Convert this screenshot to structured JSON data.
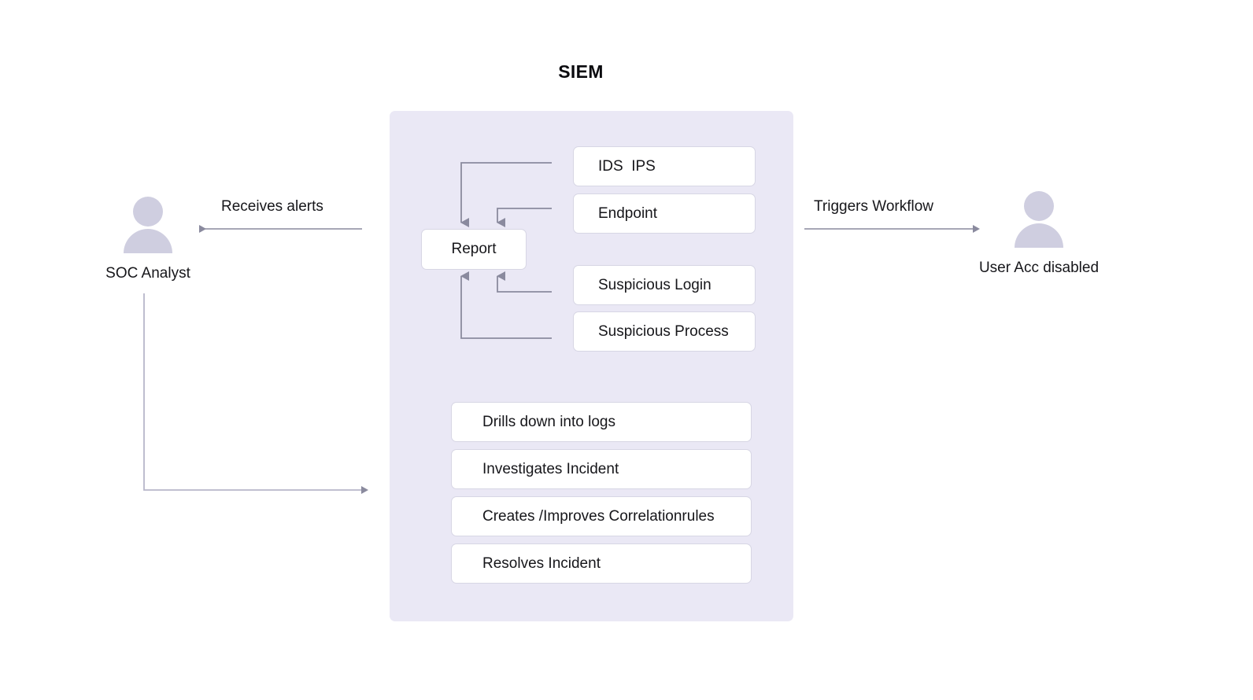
{
  "title": "SIEM",
  "colors": {
    "panel_background": "#eae8f5",
    "box_background": "#ffffff",
    "box_border": "#d7d6e4",
    "connector": "#8a8a9e",
    "actor_fill": "#cfcee0",
    "text": "#16161a",
    "title_text": "#0b0b0f",
    "page_background": "#ffffff"
  },
  "actors": {
    "left": {
      "label": "SOC Analyst",
      "icon": "person-icon"
    },
    "right": {
      "label": "User Acc disabled",
      "icon": "person-icon"
    }
  },
  "edge_labels": {
    "receives_alerts": "Receives alerts",
    "triggers_workflow": "Triggers Workflow"
  },
  "siem": {
    "report": {
      "label": "Report"
    },
    "sources": [
      {
        "label": "IDS  IPS"
      },
      {
        "label": "Endpoint"
      },
      {
        "label": "Suspicious Login"
      },
      {
        "label": "Suspicious Process"
      }
    ],
    "analyst_actions": [
      {
        "label": "Drills down into logs"
      },
      {
        "label": "Investigates Incident"
      },
      {
        "label": "Creates /Improves Correlationrules"
      },
      {
        "label": "Resolves Incident"
      }
    ]
  }
}
